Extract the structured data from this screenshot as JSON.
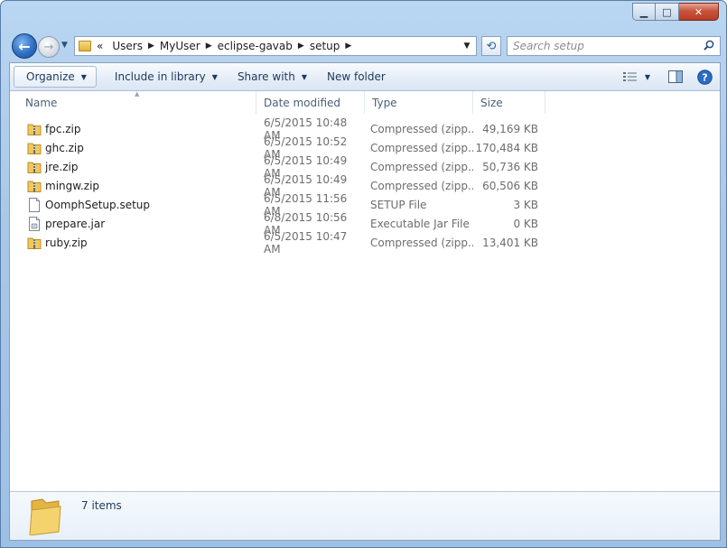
{
  "window": {
    "minimize_glyph": "▁",
    "maximize_glyph": "□",
    "close_glyph": "✕"
  },
  "nav": {
    "back_glyph": "←",
    "forward_glyph": "→",
    "recent_glyph": "▼",
    "breadcrumb_overflow": "«",
    "breadcrumbs": [
      "Users",
      "MyUser",
      "eclipse-gavab",
      "setup"
    ],
    "refresh_glyph": "⟲"
  },
  "search": {
    "placeholder": "Search setup"
  },
  "toolbar": {
    "organize": "Organize",
    "include_in_library": "Include in library",
    "share_with": "Share with",
    "new_folder": "New folder"
  },
  "columns": {
    "name": "Name",
    "date": "Date modified",
    "type": "Type",
    "size": "Size"
  },
  "files": [
    {
      "name": "fpc.zip",
      "date": "6/5/2015 10:48 AM",
      "type": "Compressed (zipp...",
      "size": "49,169 KB",
      "icon": "zip-folder-icon"
    },
    {
      "name": "ghc.zip",
      "date": "6/5/2015 10:52 AM",
      "type": "Compressed (zipp...",
      "size": "170,484 KB",
      "icon": "zip-folder-icon"
    },
    {
      "name": "jre.zip",
      "date": "6/5/2015 10:49 AM",
      "type": "Compressed (zipp...",
      "size": "50,736 KB",
      "icon": "zip-folder-icon"
    },
    {
      "name": "mingw.zip",
      "date": "6/5/2015 10:49 AM",
      "type": "Compressed (zipp...",
      "size": "60,506 KB",
      "icon": "zip-folder-icon"
    },
    {
      "name": "OomphSetup.setup",
      "date": "6/5/2015 11:56 AM",
      "type": "SETUP File",
      "size": "3 KB",
      "icon": "generic-file-icon"
    },
    {
      "name": "prepare.jar",
      "date": "6/8/2015 10:56 AM",
      "type": "Executable Jar File",
      "size": "0 KB",
      "icon": "jar-file-icon"
    },
    {
      "name": "ruby.zip",
      "date": "6/5/2015 10:47 AM",
      "type": "Compressed (zipp...",
      "size": "13,401 KB",
      "icon": "zip-folder-icon"
    }
  ],
  "status": {
    "items_count": "7 items"
  },
  "colors": {
    "accent": "#1e395b",
    "folder": "#e9bf4a",
    "frame": "#a9c8e8"
  }
}
